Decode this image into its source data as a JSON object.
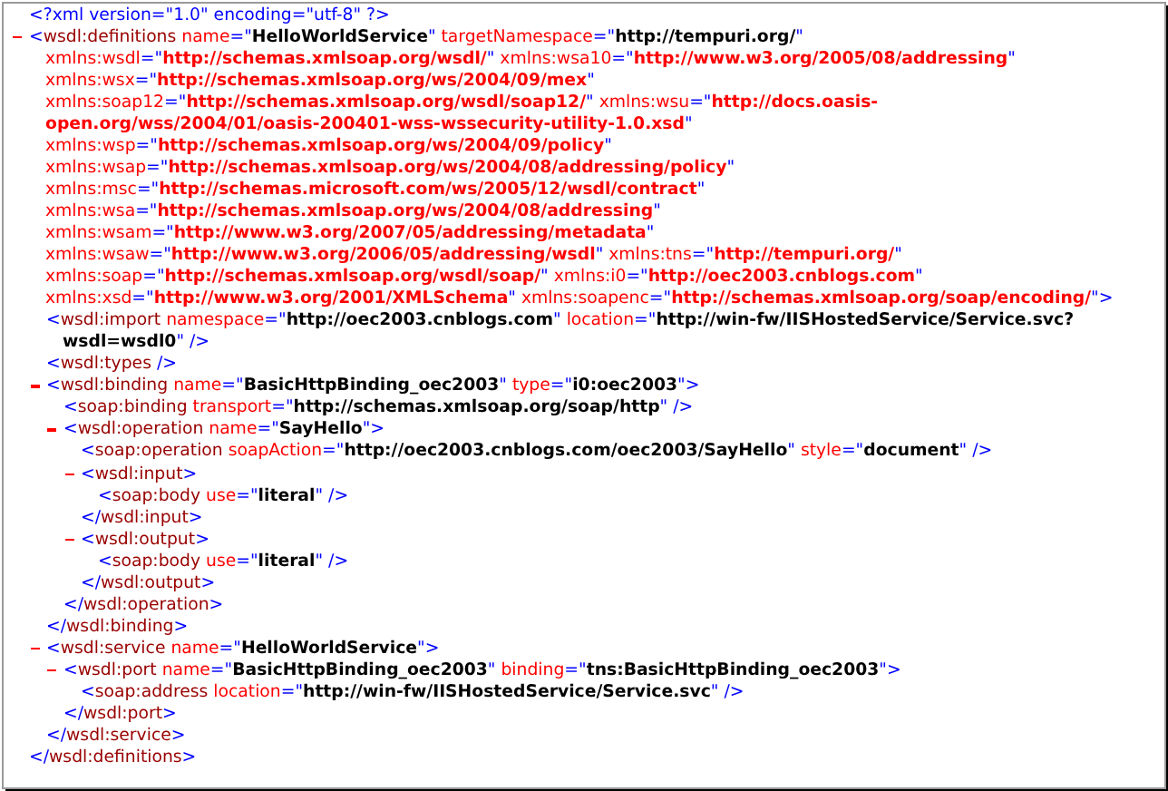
{
  "document": [
    {
      "open": [
        {
          "kind": "pi",
          "text": "<?xml version=\"1.0\" encoding=\"utf-8\" ?>"
        }
      ]
    },
    {
      "expanded": true,
      "open": [
        {
          "kind": "markup",
          "text": "<wsdl:definitions name=\"HelloWorldService\" targetNamespace=\"http://tempuri.org/\""
        },
        {
          "kind": "ns",
          "text": "xmlns:wsdl=\"http://schemas.xmlsoap.org/wsdl/\" xmlns:wsa10=\"http://www.w3.org/2005/08/addressing\""
        },
        {
          "kind": "ns",
          "text": "xmlns:wsx=\"http://schemas.xmlsoap.org/ws/2004/09/mex\""
        },
        {
          "kind": "ns",
          "text": "xmlns:soap12=\"http://schemas.xmlsoap.org/wsdl/soap12/\" xmlns:wsu=\"http://docs.oasis-"
        },
        {
          "kind": "ns-wrap",
          "text": "open.org/wss/2004/01/oasis-200401-wss-wssecurity-utility-1.0.xsd\""
        },
        {
          "kind": "ns",
          "text": "xmlns:wsp=\"http://schemas.xmlsoap.org/ws/2004/09/policy\""
        },
        {
          "kind": "ns",
          "text": "xmlns:wsap=\"http://schemas.xmlsoap.org/ws/2004/08/addressing/policy\""
        },
        {
          "kind": "ns",
          "text": "xmlns:msc=\"http://schemas.microsoft.com/ws/2005/12/wsdl/contract\""
        },
        {
          "kind": "ns",
          "text": "xmlns:wsa=\"http://schemas.xmlsoap.org/ws/2004/08/addressing\""
        },
        {
          "kind": "ns",
          "text": "xmlns:wsam=\"http://www.w3.org/2007/05/addressing/metadata\""
        },
        {
          "kind": "ns",
          "text": "xmlns:wsaw=\"http://www.w3.org/2006/05/addressing/wsdl\" xmlns:tns=\"http://tempuri.org/\""
        },
        {
          "kind": "ns",
          "text": "xmlns:soap=\"http://schemas.xmlsoap.org/wsdl/soap/\" xmlns:i0=\"http://oec2003.cnblogs.com\""
        },
        {
          "kind": "ns",
          "text": "xmlns:xsd=\"http://www.w3.org/2001/XMLSchema\" xmlns:soapenc=\"http://schemas.xmlsoap.org/soap/encoding/\">"
        }
      ],
      "close": "</wsdl:definitions>",
      "children": [
        {
          "open": [
            {
              "kind": "markup",
              "text": "<wsdl:import namespace=\"http://oec2003.cnblogs.com\" location=\"http://win-fw/IISHostedService/Service.svc?"
            },
            {
              "kind": "wrap",
              "text": "wsdl=wsdl0\" />"
            }
          ]
        },
        {
          "open": [
            {
              "kind": "markup",
              "text": "<wsdl:types />"
            }
          ]
        },
        {
          "expanded": true,
          "open": [
            {
              "kind": "markup",
              "text": "<wsdl:binding name=\"BasicHttpBinding_oec2003\" type=\"i0:oec2003\">"
            }
          ],
          "close": "</wsdl:binding>",
          "children": [
            {
              "open": [
                {
                  "kind": "markup",
                  "text": "<soap:binding transport=\"http://schemas.xmlsoap.org/soap/http\" />"
                }
              ]
            },
            {
              "expanded": true,
              "open": [
                {
                  "kind": "markup",
                  "text": "<wsdl:operation name=\"SayHello\">"
                }
              ],
              "close": "</wsdl:operation>",
              "children": [
                {
                  "open": [
                    {
                      "kind": "markup",
                      "text": "<soap:operation soapAction=\"http://oec2003.cnblogs.com/oec2003/SayHello\" style=\"document\" />"
                    }
                  ]
                },
                {
                  "expanded": true,
                  "open": [
                    {
                      "kind": "markup",
                      "text": "<wsdl:input>"
                    }
                  ],
                  "close": "</wsdl:input>",
                  "children": [
                    {
                      "open": [
                        {
                          "kind": "markup",
                          "text": "<soap:body use=\"literal\" />"
                        }
                      ]
                    }
                  ]
                },
                {
                  "expanded": true,
                  "open": [
                    {
                      "kind": "markup",
                      "text": "<wsdl:output>"
                    }
                  ],
                  "close": "</wsdl:output>",
                  "children": [
                    {
                      "open": [
                        {
                          "kind": "markup",
                          "text": "<soap:body use=\"literal\" />"
                        }
                      ]
                    }
                  ]
                }
              ]
            }
          ]
        },
        {
          "expanded": true,
          "open": [
            {
              "kind": "markup",
              "text": "<wsdl:service name=\"HelloWorldService\">"
            }
          ],
          "close": "</wsdl:service>",
          "children": [
            {
              "expanded": true,
              "open": [
                {
                  "kind": "markup",
                  "text": "<wsdl:port name=\"BasicHttpBinding_oec2003\" binding=\"tns:BasicHttpBinding_oec2003\">"
                }
              ],
              "close": "</wsdl:port>",
              "children": [
                {
                  "open": [
                    {
                      "kind": "markup",
                      "text": "<soap:address location=\"http://win-fw/IISHostedService/Service.svc\" />"
                    }
                  ]
                }
              ]
            }
          ]
        }
      ]
    }
  ]
}
